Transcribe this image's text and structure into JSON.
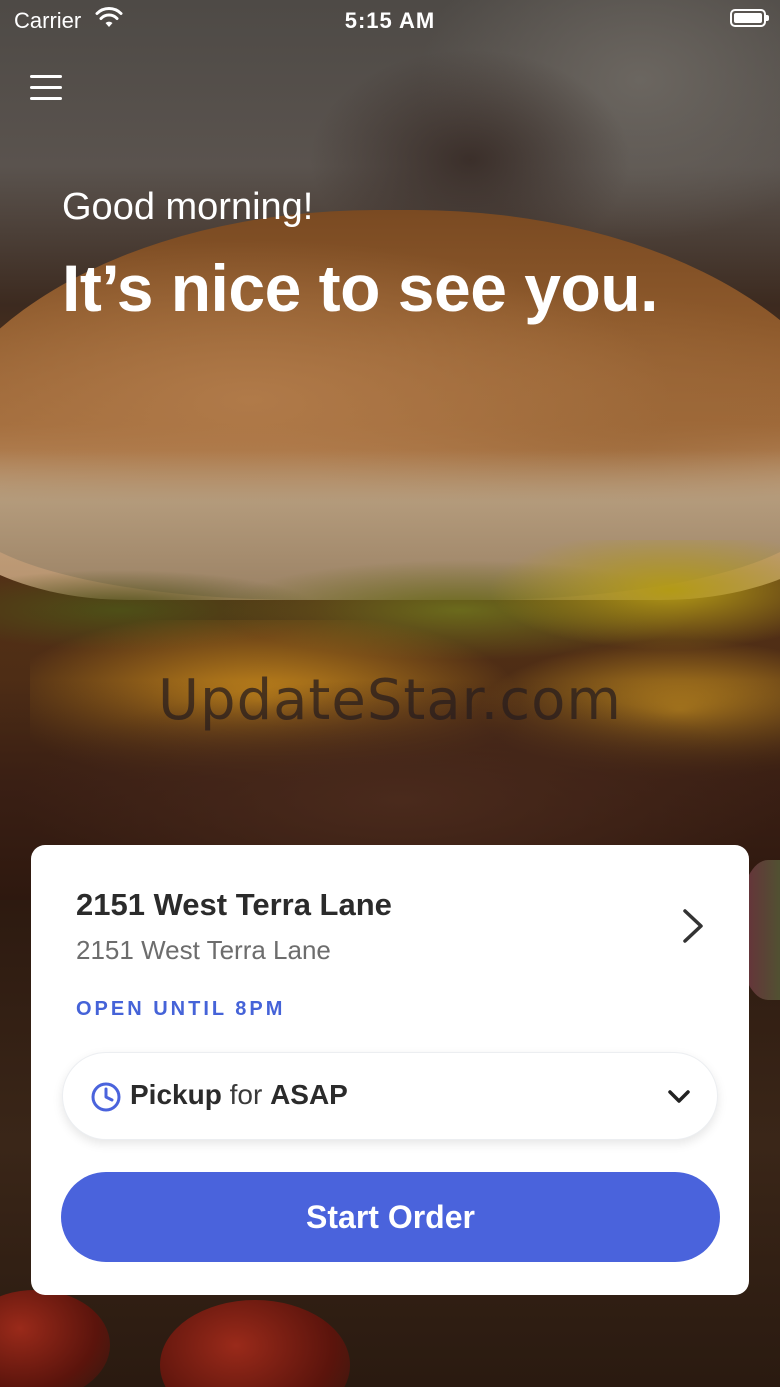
{
  "status_bar": {
    "carrier": "Carrier",
    "time": "5:15 AM"
  },
  "hero": {
    "greeting": "Good morning!",
    "headline": "It’s nice to see you.",
    "watermark": "UpdateStar.com"
  },
  "store": {
    "name": "2151 West Terra Lane",
    "address": "2151 West Terra Lane",
    "hours": "OPEN UNTIL 8PM"
  },
  "order_mode": {
    "mode": "Pickup",
    "connector": "for",
    "time": "ASAP"
  },
  "actions": {
    "start_order": "Start Order"
  },
  "colors": {
    "accent": "#4a63dc",
    "hours_text": "#4563d8",
    "card_bg": "#ffffff"
  },
  "icons": [
    "wifi-icon",
    "battery-icon",
    "menu-icon",
    "chevron-right-icon",
    "clock-icon",
    "chevron-down-icon"
  ]
}
